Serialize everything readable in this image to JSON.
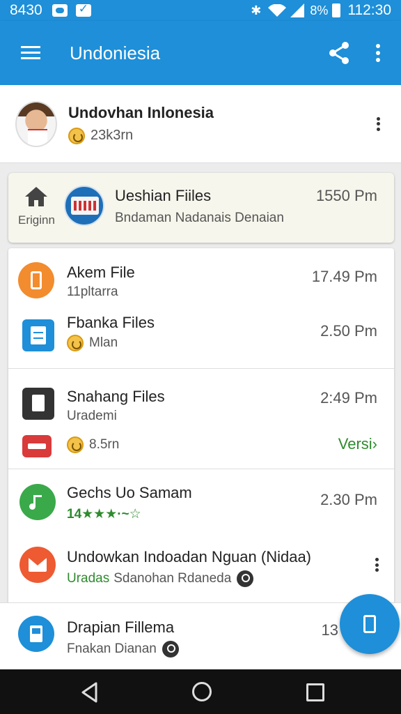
{
  "status_bar": {
    "time_left": "8430",
    "battery": "8%",
    "time_right": "112:30"
  },
  "app_bar": {
    "title": "Undoniesia"
  },
  "profile": {
    "name": "Undovhan Inlonesia",
    "sub": "23k3rn"
  },
  "origin_card": {
    "origin_label": "Eriginn",
    "title": "Ueshian Fiiles",
    "subtitle": "Bndaman Nadanais Denaian",
    "time": "1550 Pm"
  },
  "list": [
    {
      "title": "Akem File",
      "subtitle": "11pltarra",
      "time": "17.49 Pm",
      "icon": "phone-icon",
      "color": "#f28c2e"
    },
    {
      "title": "Fbanka Files",
      "subtitle": "Mlan",
      "time": "2.50 Pm",
      "icon": "document-icon",
      "color": "#1e8fd8"
    },
    {
      "title": "Snahang Files",
      "subtitle": "Urademi",
      "time": "2:49 Pm",
      "icon": "file-icon",
      "color": "#333333"
    },
    {
      "title": "",
      "subtitle": "8.5rn",
      "time": "",
      "action": "Versi›",
      "icon": "card-icon",
      "color": "#d93a3a"
    },
    {
      "title": "Gechs Uo Samam",
      "subtitle": "14★★★·~☆",
      "time": "2.30 Pm",
      "icon": "music-icon",
      "color": "#3aa94a"
    },
    {
      "title": "Undowkan Indoadan Nguan (Nidaa)",
      "subtitle_green": "Uradas",
      "subtitle": "Sdanohan Rdaneda",
      "icon": "mail-icon",
      "color": "#ee5a32"
    }
  ],
  "bottom_row": {
    "title": "Drapian Fillema",
    "subtitle": "Fnakan Dianan",
    "time": "13"
  },
  "colors": {
    "primary": "#1e8fd8",
    "accent_green": "#2e8b2e"
  }
}
